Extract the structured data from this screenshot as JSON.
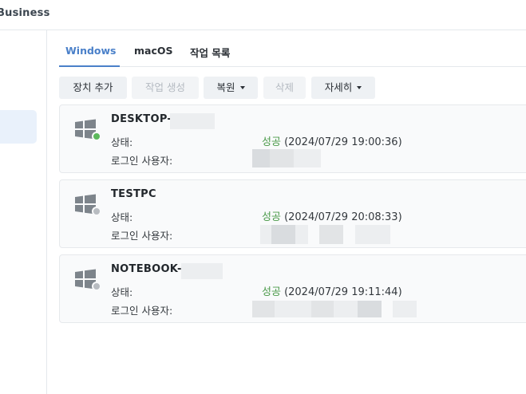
{
  "header": {
    "app_title": "Business"
  },
  "tabs": [
    {
      "label": "Windows",
      "active": true
    },
    {
      "label": "macOS",
      "active": false
    },
    {
      "label": "작업 목록",
      "active": false
    }
  ],
  "toolbar": {
    "add_device": "장치 추가",
    "create_task": "작업 생성",
    "restore": "복원",
    "delete": "삭제",
    "details": "자세히"
  },
  "labels": {
    "status": "상태:",
    "login_user": "로그인 사용자:"
  },
  "colors": {
    "accent": "#4a80c9",
    "success_text": "#4b9a4a",
    "online_dot": "#5cb85c",
    "offline_dot": "#b8bcc1"
  },
  "devices": [
    {
      "name": "DESKTOP-",
      "status_text": "성공",
      "status_time": "(2024/07/29 19:00:36)",
      "online": true,
      "icon": "windows-icon"
    },
    {
      "name": "TESTPC",
      "status_text": "성공",
      "status_time": "(2024/07/29 20:08:33)",
      "online": false,
      "icon": "windows-icon"
    },
    {
      "name": "NOTEBOOK-",
      "status_text": "성공",
      "status_time": "(2024/07/29 19:11:44)",
      "online": false,
      "icon": "windows-icon"
    }
  ]
}
